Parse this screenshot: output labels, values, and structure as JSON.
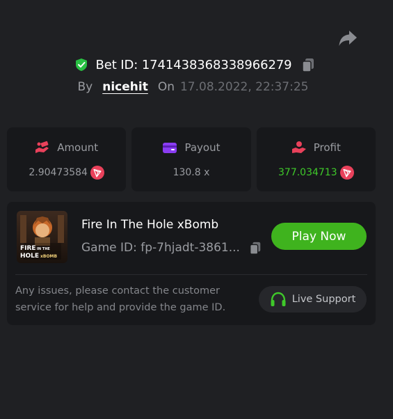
{
  "header": {
    "bet_id": "Bet ID: 1741438368338966279",
    "by_label": "By",
    "username": "nicehit",
    "on_label": "On",
    "date": "17.08.2022, 22:37:25"
  },
  "stats": [
    {
      "label": "Amount",
      "value": "2.90473584",
      "icon": "money-hand-icon",
      "currency_icon": "tron-icon"
    },
    {
      "label": "Payout",
      "value": "130.8 x",
      "icon": "wallet-icon"
    },
    {
      "label": "Profit",
      "value": "377.034713",
      "icon": "profit-hand-icon",
      "currency_icon": "tron-icon"
    }
  ],
  "game": {
    "title": "Fire In The Hole xBomb",
    "game_id": "Game ID: fp-7hjadt-3861...",
    "play_label": "Play Now",
    "thumb_text": "FIRE IN THE HOLE xBOMB"
  },
  "support": {
    "text": "Any issues, please contact the customer service for help and provide the game ID.",
    "button_label": "Live Support"
  },
  "colors": {
    "background": "#1f2023",
    "card": "#17181b",
    "accent_green": "#3fb31e",
    "profit_green": "#3fc92a",
    "tron_red": "#e9415b"
  }
}
